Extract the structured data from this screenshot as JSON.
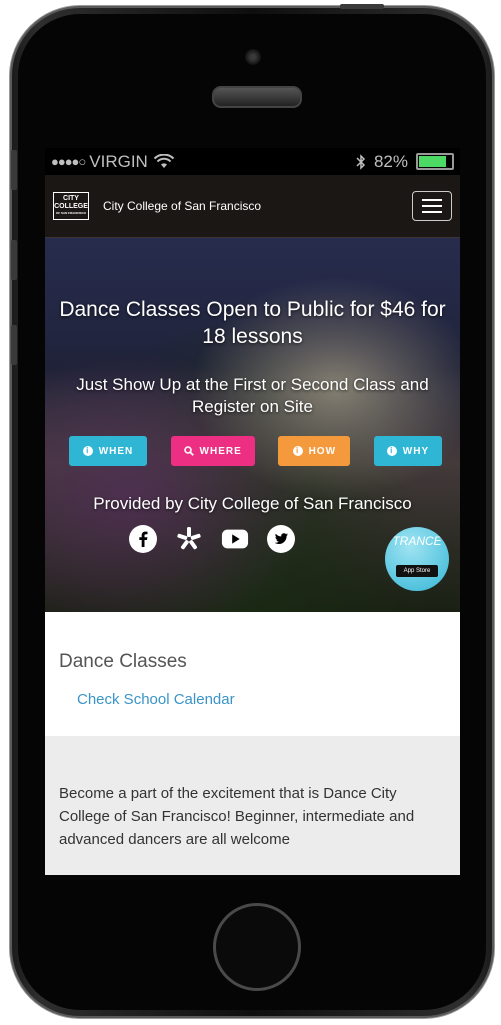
{
  "status_bar": {
    "signal": "●●●●○",
    "carrier": "VIRGIN",
    "battery": "82%"
  },
  "navbar": {
    "logo_lines": [
      "CITY",
      "COLLEGE",
      "OF SAN FRANCISCO"
    ],
    "site_name": "City College of San Francisco",
    "menu_icon": "hamburger-icon"
  },
  "hero": {
    "title": "Dance Classes Open to Public for $46 for 18 lessons",
    "subtitle": "Just Show Up at the First or Second Class and Register on Site",
    "buttons": [
      {
        "label": "WHEN",
        "icon": "info-icon",
        "glyph": "i",
        "color": "#2fb6d4"
      },
      {
        "label": "WHERE",
        "icon": "search-icon",
        "color": "#ec2f82"
      },
      {
        "label": "HOW",
        "icon": "info-icon",
        "glyph": "i",
        "color": "#f49a3d"
      },
      {
        "label": "WHY",
        "icon": "info-icon",
        "glyph": "i",
        "color": "#2fb6d4"
      }
    ],
    "provided_by": "Provided by City College of San Francisco",
    "social_icons": [
      "facebook-icon",
      "yelp-icon",
      "youtube-icon",
      "twitter-icon"
    ],
    "app_badge": {
      "title": "TRANCE",
      "store": "App Store"
    }
  },
  "content": {
    "section_title": "Dance Classes",
    "calendar_link": "Check School Calendar",
    "description": "Become a part of the excitement that is Dance City College of San Francisco! Beginner, intermediate and advanced dancers are all welcome"
  }
}
